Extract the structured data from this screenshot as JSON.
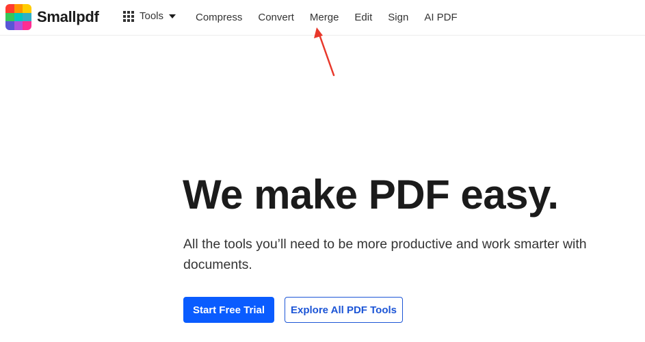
{
  "brand": {
    "name": "Smallpdf",
    "logo_colors": [
      "#ff3b30",
      "#ff9500",
      "#ffcc00",
      "#34c759",
      "#00c7be",
      "#30b0c7",
      "#5856d6",
      "#af52de",
      "#ff2d92"
    ]
  },
  "header": {
    "tools_label": "Tools",
    "nav": [
      "Compress",
      "Convert",
      "Merge",
      "Edit",
      "Sign",
      "AI PDF"
    ]
  },
  "hero": {
    "title": "We make PDF easy.",
    "subtitle": "All the tools you’ll need to be more productive and work smarter with documents.",
    "primary_cta": "Start Free Trial",
    "secondary_cta": "Explore All PDF Tools"
  },
  "colors": {
    "primary": "#0a5cff",
    "secondary_border": "#1c55d6",
    "annotation": "#e8382b"
  },
  "icons": [
    "grid-icon",
    "caret-down-icon",
    "annotation-arrow-icon"
  ]
}
